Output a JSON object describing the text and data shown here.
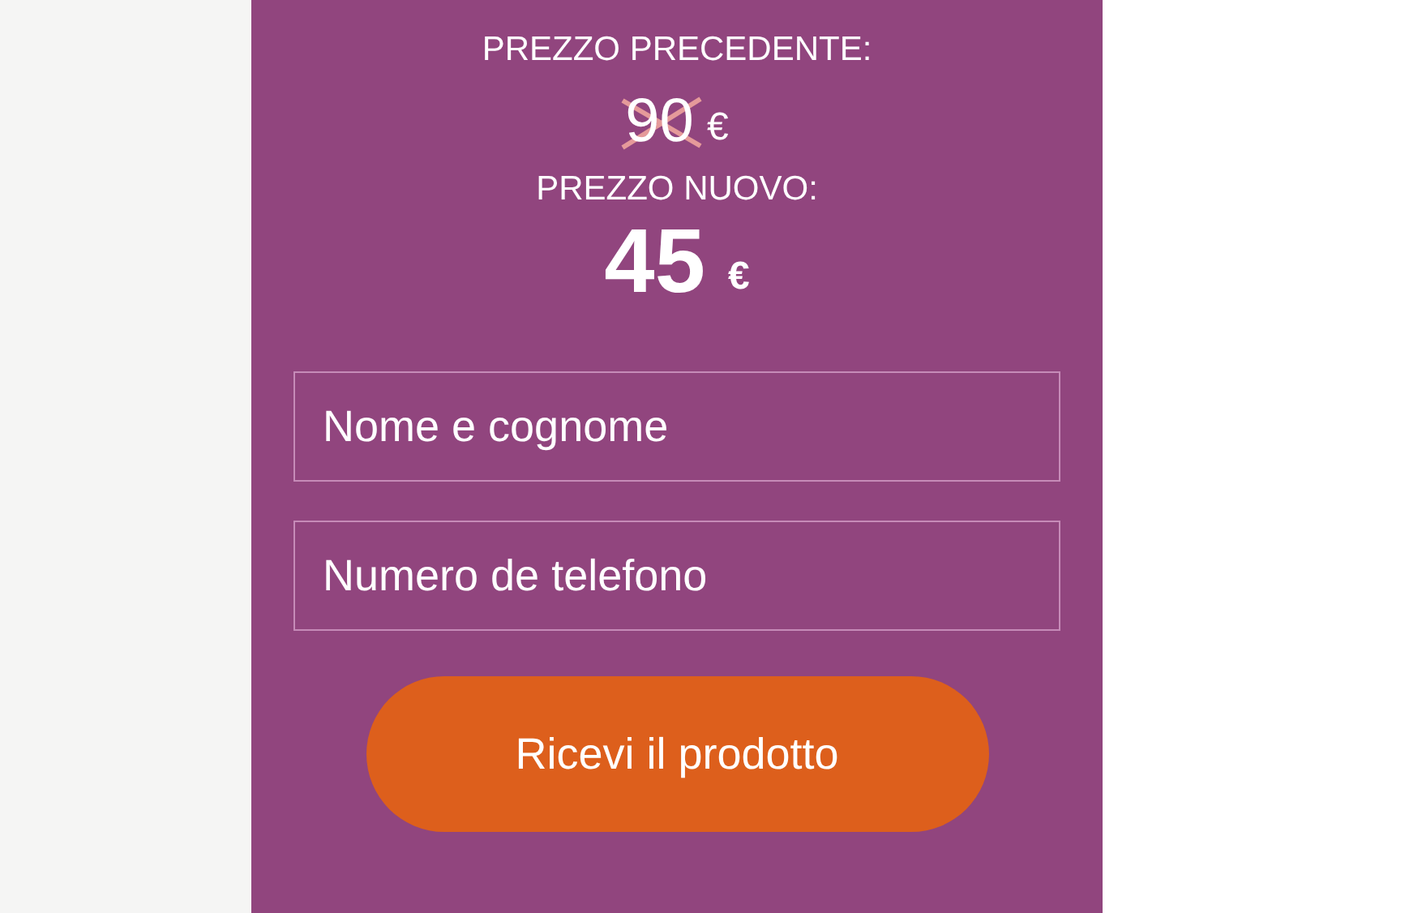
{
  "old_price": {
    "label": "PREZZO PRECEDENTE:",
    "amount": "90",
    "currency": "€",
    "crossed_out": true
  },
  "new_price": {
    "label": "PREZZO NUOVO:",
    "amount": "45",
    "currency": "€"
  },
  "fields": [
    {
      "placeholder": "Nome e cognome"
    },
    {
      "placeholder": "Numero de telefono"
    }
  ],
  "submit_button": "Ricevi il prodotto"
}
